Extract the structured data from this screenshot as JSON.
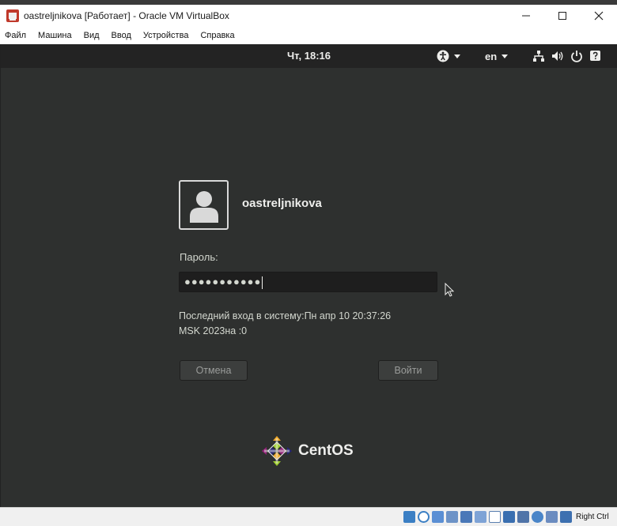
{
  "window": {
    "title": "oastreljnikova [Работает] - Oracle VM VirtualBox",
    "controls": {
      "minimize": "—",
      "maximize": "☐",
      "close": "✕"
    }
  },
  "menu": [
    "Файл",
    "Машина",
    "Вид",
    "Ввод",
    "Устройства",
    "Справка"
  ],
  "panel": {
    "clock": "Чт, 18:16",
    "language": "en",
    "icons": [
      "accessibility-icon",
      "network-icon",
      "volume-icon",
      "power-icon",
      "help-icon"
    ]
  },
  "login": {
    "username": "oastreljnikova",
    "password_label": "Пароль:",
    "password_value": "●●●●●●●●●●●",
    "last_login_line1": "Последний вход в систему:Пн апр 10 20:37:26",
    "last_login_line2": "MSK 2023на :0",
    "cancel_label": "Отмена",
    "login_label": "Войти"
  },
  "logo": {
    "text": "CentOS"
  },
  "statusbar": {
    "host_key": "Right Ctrl",
    "icons": [
      "storage-icon",
      "optical-drive-icon",
      "audio-icon",
      "network-icon",
      "usb-icon",
      "shared-folder-icon",
      "display-icon",
      "recording-icon",
      "vm-icon",
      "capture-icon",
      "mouse-integration-icon",
      "keyboard-icon"
    ]
  },
  "colors": {
    "vm_background": "#2e302f",
    "panel": "#232323",
    "text_light": "#eeeeec"
  }
}
